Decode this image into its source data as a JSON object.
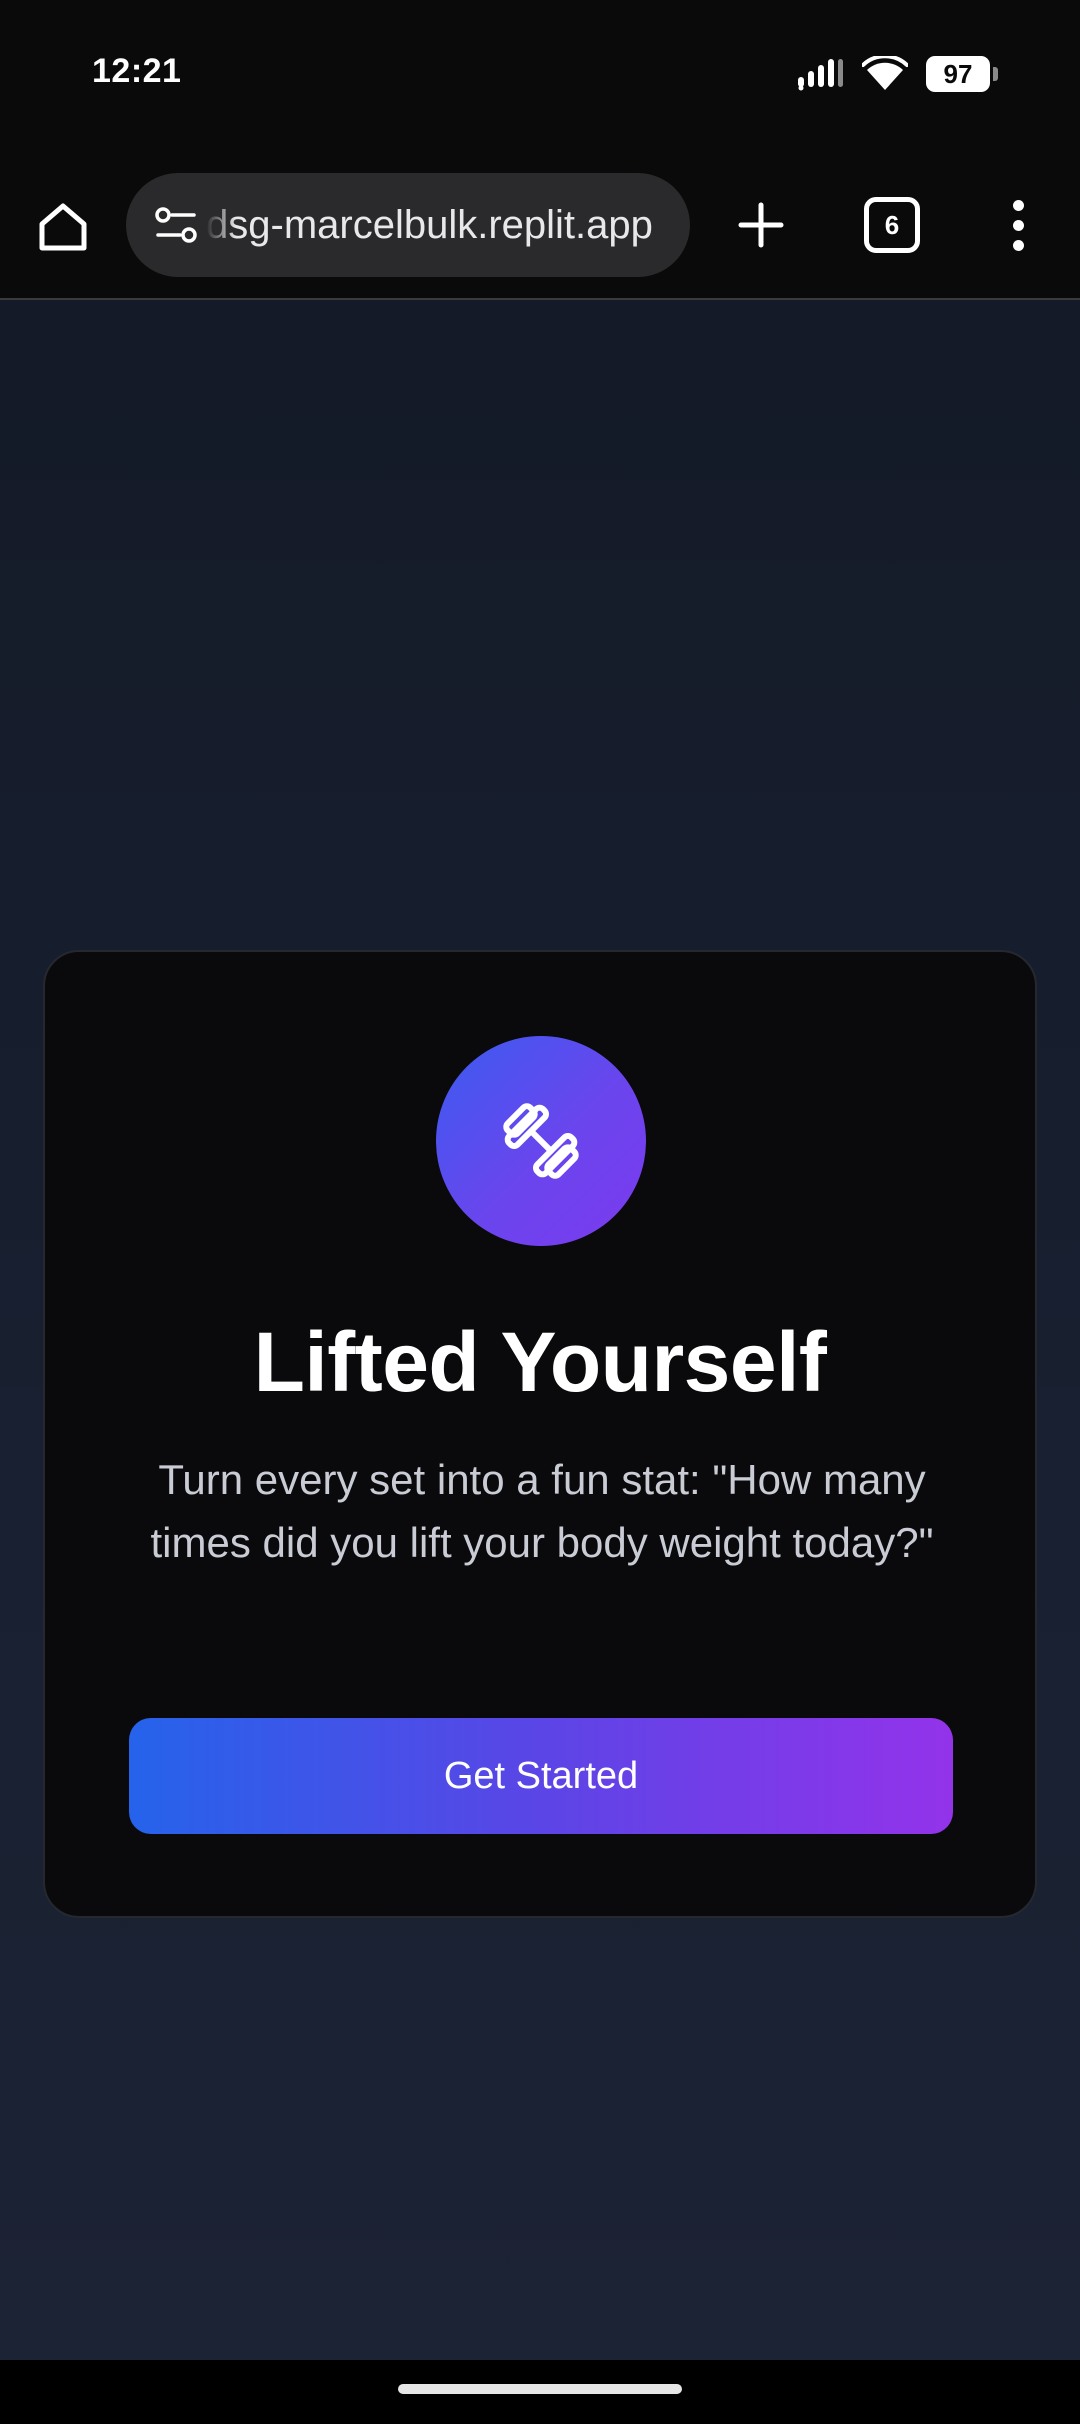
{
  "status_bar": {
    "time": "12:21",
    "battery": "97",
    "icons": [
      "signal-icon",
      "wifi-icon",
      "battery-icon"
    ]
  },
  "browser": {
    "url": "dsg-marcelbulk.replit.app",
    "tab_count": "6",
    "icons": [
      "home-icon",
      "tune-icon",
      "plus-icon",
      "tabs-icon",
      "more-vert-icon"
    ]
  },
  "card": {
    "logo_icon": "dumbbell-icon",
    "title": "Lifted Yourself",
    "tagline": "Turn every set into a fun stat: \"How many times did you lift your body weight today?\"",
    "button_label": "Get Started"
  },
  "colors": {
    "page_bg": "#182031",
    "card_bg": "#0a0a0c",
    "accent_start": "#2563eb",
    "accent_end": "#9333ea"
  }
}
